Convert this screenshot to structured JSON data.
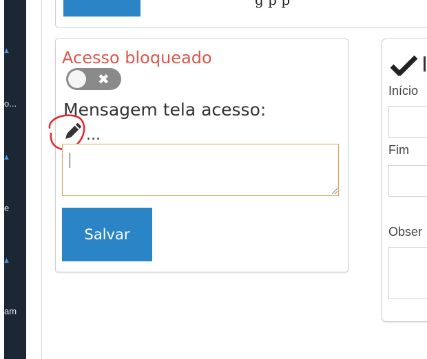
{
  "sidebar": {
    "items": [
      {
        "label": "o..."
      },
      {
        "label": "e"
      },
      {
        "label": "am"
      }
    ]
  },
  "top": {
    "partial_text": "g   p   p"
  },
  "card": {
    "title": "Acesso bloqueado",
    "message_label": "Mensagem tela acesso:",
    "message_value": "...",
    "textarea_value": "",
    "save_label": "Salvar"
  },
  "right_card": {
    "start_label": "Início",
    "end_label": "Fim",
    "notes_label": "Obser"
  },
  "colors": {
    "title": "#d8594c",
    "button": "#2b84c6",
    "textarea_border": "#e0a45c",
    "annotation": "#e3262a"
  }
}
